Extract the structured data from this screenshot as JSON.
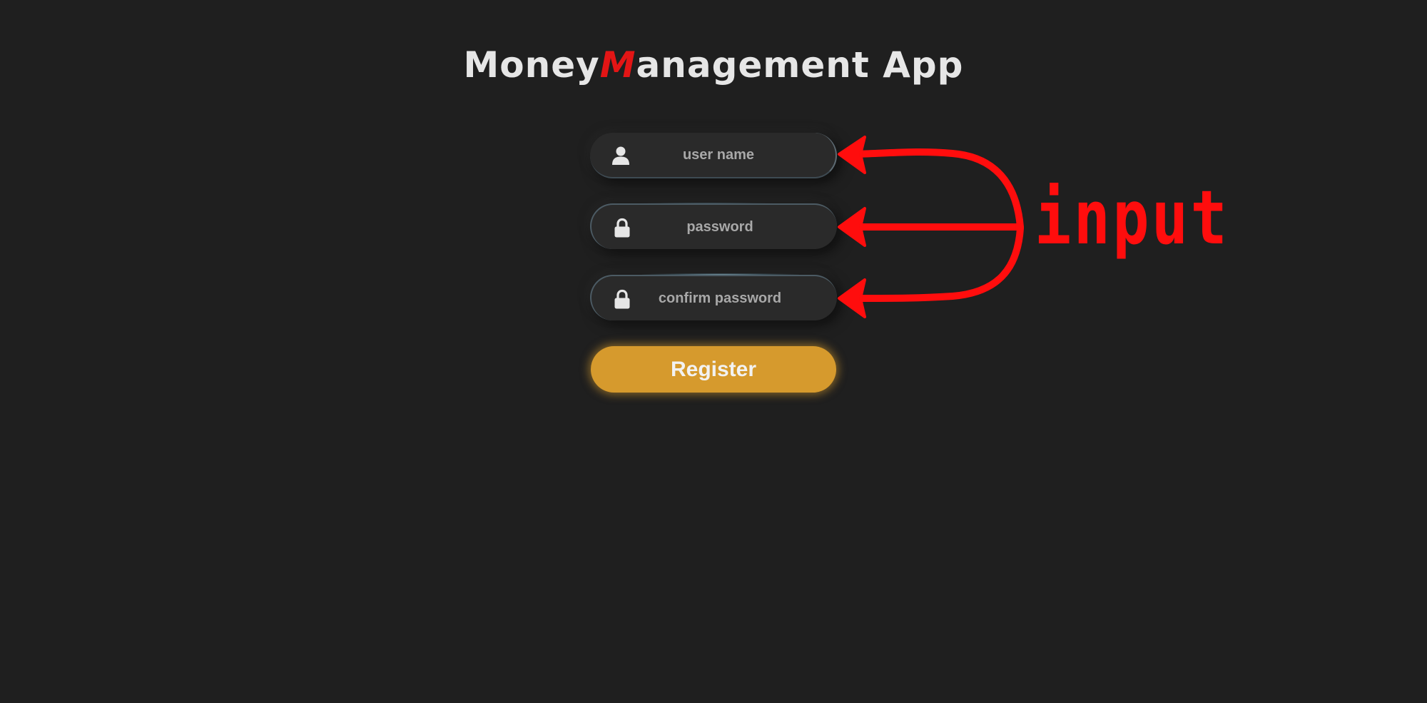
{
  "app": {
    "title_parts": [
      "Money ",
      "M",
      "anagement App"
    ]
  },
  "form": {
    "username": {
      "placeholder": "user name",
      "icon": "user-icon"
    },
    "password": {
      "placeholder": "password",
      "icon": "lock-icon"
    },
    "confirm_password": {
      "placeholder": "confirm password",
      "icon": "lock-icon"
    },
    "register_label": "Register"
  },
  "annotation": {
    "label": "input",
    "color": "#ff0d0d"
  },
  "colors": {
    "background": "#1f1f1f",
    "field_bg": "#2a2a2a",
    "accent_button": "#d69a2d",
    "title_accent": "#e31515"
  }
}
